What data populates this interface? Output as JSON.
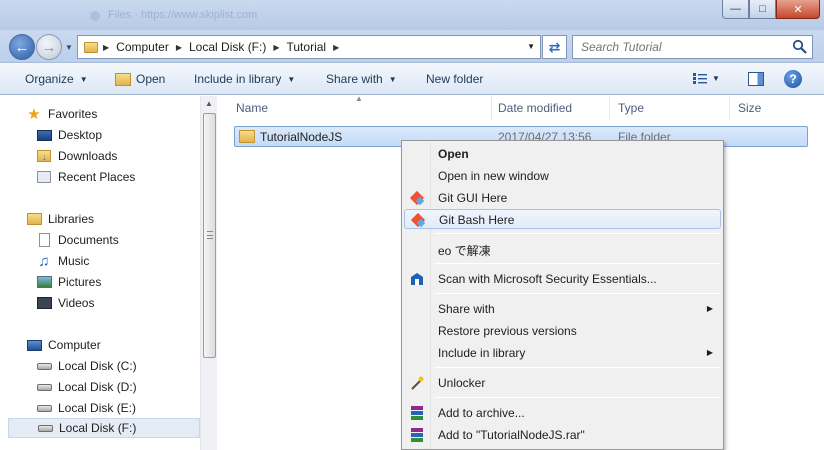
{
  "window": {
    "ghost_title": "Files · https://www.skiplist.com",
    "controls": {
      "minimize": "—",
      "maximize": "□",
      "close": "✕"
    }
  },
  "address": {
    "crumbs": [
      "Computer",
      "Local Disk (F:)",
      "Tutorial"
    ],
    "search_placeholder": "Search Tutorial"
  },
  "toolbar": {
    "organize": "Organize",
    "open": "Open",
    "include_in_library": "Include in library",
    "share_with": "Share with",
    "new_folder": "New folder",
    "help": "?"
  },
  "nav": {
    "favorites": "Favorites",
    "desktop": "Desktop",
    "downloads": "Downloads",
    "recent_places": "Recent Places",
    "libraries": "Libraries",
    "documents": "Documents",
    "music": "Music",
    "pictures": "Pictures",
    "videos": "Videos",
    "computer": "Computer",
    "disk_c": "Local Disk (C:)",
    "disk_d": "Local Disk (D:)",
    "disk_e": "Local Disk (E:)",
    "disk_f": "Local Disk (F:)"
  },
  "columns": {
    "name": "Name",
    "date_modified": "Date modified",
    "type": "Type",
    "size": "Size"
  },
  "files": [
    {
      "name": "TutorialNodeJS",
      "date_modified": "2017/04/27 13:56",
      "type": "File folder"
    }
  ],
  "context_menu": {
    "open": "Open",
    "open_new_window": "Open in new window",
    "git_gui": "Git GUI Here",
    "git_bash": "Git Bash Here",
    "eo_extract": "eo で解凍",
    "scan": "Scan with Microsoft Security Essentials...",
    "share_with": "Share with",
    "restore": "Restore previous versions",
    "include_library": "Include in library",
    "unlocker": "Unlocker",
    "add_archive": "Add to archive...",
    "add_rar": "Add to \"TutorialNodeJS.rar\""
  },
  "colors": {
    "accent": "#2a5ea8",
    "selection": "#c3dbf8",
    "menu_bg": "#f0f0f0"
  }
}
